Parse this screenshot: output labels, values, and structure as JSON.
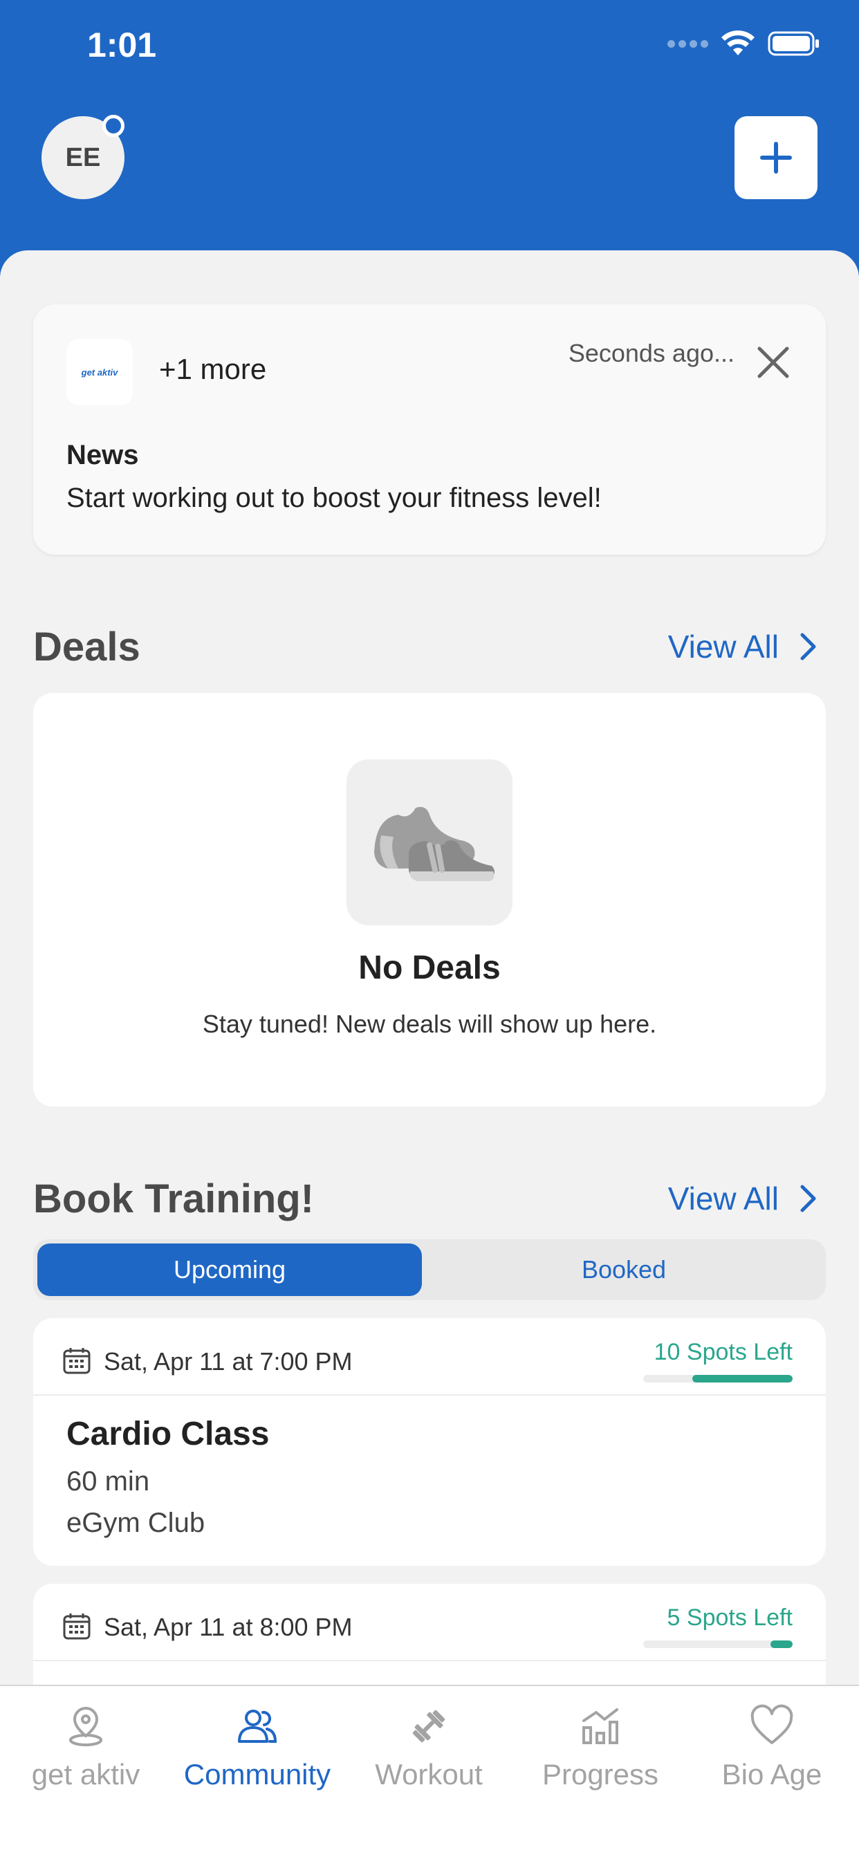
{
  "status_bar": {
    "time": "1:01"
  },
  "header": {
    "avatar_initials": "EE"
  },
  "news": {
    "logo_text": "get aktiv",
    "more_label": "+1 more",
    "time_label": "Seconds ago...",
    "title": "News",
    "body": "Start working out to boost your fitness level!"
  },
  "deals": {
    "section_title": "Deals",
    "view_all": "View All",
    "empty_title": "No Deals",
    "empty_subtitle": "Stay tuned! New deals will show up here."
  },
  "training": {
    "section_title": "Book Training!",
    "view_all": "View All",
    "tabs": [
      {
        "label": "Upcoming",
        "active": true
      },
      {
        "label": "Booked",
        "active": false
      }
    ],
    "sessions": [
      {
        "date": "Sat, Apr 11 at 7:00 PM",
        "spots": "10 Spots Left",
        "spots_fraction": 0.67,
        "name": "Cardio Class",
        "duration": "60 min",
        "club": "eGym Club"
      },
      {
        "date": "Sat, Apr 11 at 8:00 PM",
        "spots": "5 Spots Left",
        "spots_fraction": 0.15
      }
    ]
  },
  "tabbar": {
    "items": [
      {
        "label": "get aktiv",
        "icon": "location-pin-icon",
        "active": false
      },
      {
        "label": "Community",
        "icon": "people-icon",
        "active": true
      },
      {
        "label": "Workout",
        "icon": "dumbbell-icon",
        "active": false
      },
      {
        "label": "Progress",
        "icon": "bar-chart-icon",
        "active": false
      },
      {
        "label": "Bio Age",
        "icon": "heart-icon",
        "active": false
      }
    ]
  },
  "colors": {
    "brand_blue": "#1f67c4",
    "spots_green": "#2aa68c",
    "inactive_gray": "#a3a3a3"
  }
}
